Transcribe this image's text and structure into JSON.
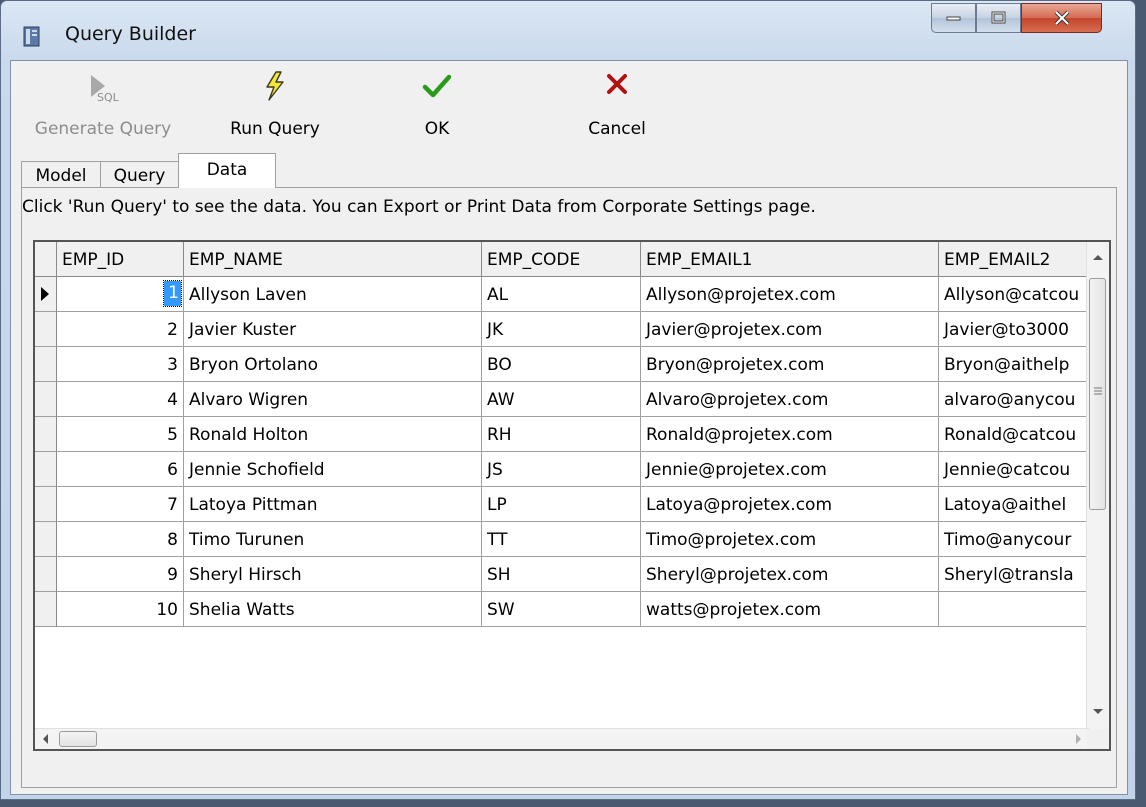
{
  "window": {
    "title": "Query Builder"
  },
  "toolbar": {
    "generate_label": "Generate Query",
    "generate_icon_text": "SQL",
    "run_label": "Run Query",
    "ok_label": "OK",
    "cancel_label": "Cancel"
  },
  "tabs": [
    {
      "label": "Model"
    },
    {
      "label": "Query"
    },
    {
      "label": "Data",
      "active": true
    }
  ],
  "hint": "Click 'Run Query' to see the data. You can Export or Print Data from Corporate Settings page.",
  "grid": {
    "columns": [
      "EMP_ID",
      "EMP_NAME",
      "EMP_CODE",
      "EMP_EMAIL1",
      "EMP_EMAIL2"
    ],
    "rows": [
      {
        "id": "1",
        "name": "Allyson Laven",
        "code": "AL",
        "email1": "Allyson@projetex.com",
        "email2": "Allyson@catcou"
      },
      {
        "id": "2",
        "name": "Javier Kuster",
        "code": "JK",
        "email1": "Javier@projetex.com",
        "email2": "Javier@to3000"
      },
      {
        "id": "3",
        "name": "Bryon Ortolano",
        "code": "BO",
        "email1": "Bryon@projetex.com",
        "email2": "Bryon@aithelp"
      },
      {
        "id": "4",
        "name": "Alvaro Wigren",
        "code": "AW",
        "email1": "Alvaro@projetex.com",
        "email2": "alvaro@anycou"
      },
      {
        "id": "5",
        "name": "Ronald Holton",
        "code": "RH",
        "email1": "Ronald@projetex.com",
        "email2": "Ronald@catcou"
      },
      {
        "id": "6",
        "name": "Jennie Schofield",
        "code": "JS",
        "email1": "Jennie@projetex.com",
        "email2": "Jennie@catcou"
      },
      {
        "id": "7",
        "name": "Latoya Pittman",
        "code": "LP",
        "email1": "Latoya@projetex.com",
        "email2": "Latoya@aithel"
      },
      {
        "id": "8",
        "name": "Timo Turunen",
        "code": "TT",
        "email1": "Timo@projetex.com",
        "email2": "Timo@anycour"
      },
      {
        "id": "9",
        "name": "Sheryl Hirsch",
        "code": "SH",
        "email1": "Sheryl@projetex.com",
        "email2": "Sheryl@transla"
      },
      {
        "id": "10",
        "name": "Shelia Watts",
        "code": "SW",
        "email1": "watts@projetex.com",
        "email2": ""
      }
    ]
  }
}
